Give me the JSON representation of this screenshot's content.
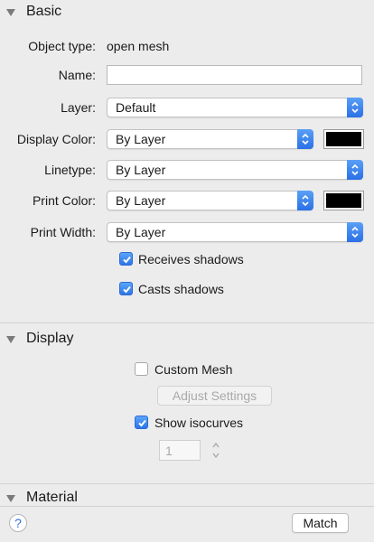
{
  "basic": {
    "title": "Basic",
    "object_type_label": "Object type:",
    "object_type_value": "open mesh",
    "name_label": "Name:",
    "name_value": "",
    "layer_label": "Layer:",
    "layer_value": "Default",
    "display_color_label": "Display Color:",
    "display_color_value": "By Layer",
    "display_color_swatch": "#000000",
    "linetype_label": "Linetype:",
    "linetype_value": "By Layer",
    "print_color_label": "Print Color:",
    "print_color_value": "By Layer",
    "print_color_swatch": "#000000",
    "print_width_label": "Print Width:",
    "print_width_value": "By Layer",
    "receives_shadows_label": "Receives shadows",
    "receives_shadows_checked": true,
    "casts_shadows_label": "Casts shadows",
    "casts_shadows_checked": true
  },
  "display": {
    "title": "Display",
    "custom_mesh_label": "Custom Mesh",
    "custom_mesh_checked": false,
    "adjust_settings_label": "Adjust Settings",
    "show_isocurves_label": "Show isocurves",
    "show_isocurves_checked": true,
    "isocurve_density_value": "1"
  },
  "material": {
    "title": "Material"
  },
  "footer": {
    "help_label": "?",
    "match_label": "Match"
  },
  "colors": {
    "accent": "#2d74e8",
    "background": "#ececec"
  }
}
